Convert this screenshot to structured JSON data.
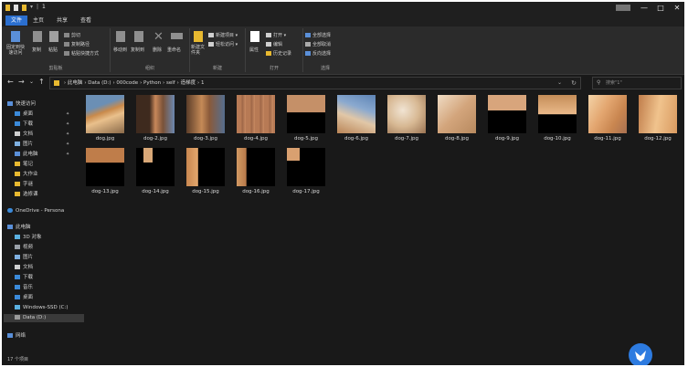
{
  "title": {
    "path": "1",
    "menu_glyph": "≡",
    "min": "—",
    "max": "□",
    "close": "✕"
  },
  "tabs": [
    "文件",
    "主页",
    "共享",
    "查看"
  ],
  "ribbon": {
    "clipboard": {
      "pin": "固定到快速访问",
      "copy": "复制",
      "paste": "粘贴",
      "cut": "剪切",
      "copy_path": "复制路径",
      "paste_shortcut": "粘贴快捷方式",
      "label": "剪贴板"
    },
    "organize": {
      "move_to": "移动到",
      "copy_to": "复制到",
      "delete": "删除",
      "rename": "重命名",
      "label": "组织"
    },
    "new": {
      "new_folder": "新建文件夹",
      "new_item": "新建项目 ▾",
      "easy_access": "轻松访问 ▾",
      "label": "新建"
    },
    "open": {
      "properties": "属性",
      "open": "打开 ▾",
      "edit": "编辑",
      "history": "历史记录",
      "label": "打开"
    },
    "select": {
      "select_all": "全部选择",
      "select_none": "全部取消",
      "invert": "反向选择",
      "label": "选择"
    }
  },
  "nav": {
    "back": "←",
    "forward": "→",
    "down": "⌄",
    "up": "↑"
  },
  "breadcrumb": [
    "此电脑",
    "Data (D:)",
    "000code",
    "Python",
    "self",
    "造梯度",
    "1"
  ],
  "search_placeholder": "搜索\"1\"",
  "sidebar": {
    "quick_access": "快速访问",
    "quick_items": [
      "桌面",
      "下载",
      "文档",
      "图片",
      "此电脑",
      "笔记",
      "大作业",
      "字谜",
      "选修课"
    ],
    "onedrive": "OneDrive - Persona",
    "this_pc": "此电脑",
    "pc_items": [
      "3D 对象",
      "视频",
      "图片",
      "文档",
      "下载",
      "音乐",
      "桌面",
      "Windows-SSD (C:)",
      "Data (D:)"
    ],
    "network": "网络"
  },
  "files": [
    {
      "name": "dog.jpg",
      "thumb": "dog"
    },
    {
      "name": "dog-2.jpg",
      "thumb": "pole"
    },
    {
      "name": "dog-3.jpg",
      "thumb": "pole2"
    },
    {
      "name": "dog-4.jpg",
      "thumb": "floor"
    },
    {
      "name": "dog-5.jpg",
      "thumb": "blackcorner"
    },
    {
      "name": "dog-6.jpg",
      "thumb": "dog2"
    },
    {
      "name": "dog-7.jpg",
      "thumb": "fur"
    },
    {
      "name": "dog-8.jpg",
      "thumb": "fur2"
    },
    {
      "name": "dog-9.jpg",
      "thumb": "blackhalf"
    },
    {
      "name": "dog-10.jpg",
      "thumb": "dogblack"
    },
    {
      "name": "dog-11.jpg",
      "thumb": "furstripe"
    },
    {
      "name": "dog-12.jpg",
      "thumb": "furstripe2"
    },
    {
      "name": "dog-13.jpg",
      "thumb": "tophalf"
    },
    {
      "name": "dog-14.jpg",
      "thumb": "smallpiece"
    },
    {
      "name": "dog-15.jpg",
      "thumb": "strip"
    },
    {
      "name": "dog-16.jpg",
      "thumb": "strip2"
    },
    {
      "name": "dog-17.jpg",
      "thumb": "corner"
    }
  ],
  "status": "17 个项目"
}
